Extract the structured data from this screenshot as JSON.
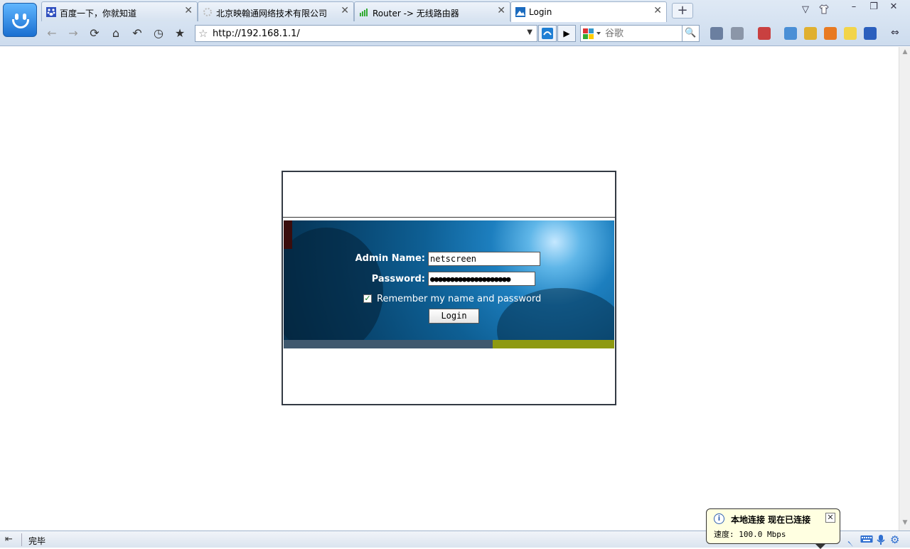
{
  "browser": {
    "tabs": [
      {
        "label": "百度一下，你就知道"
      },
      {
        "label": "北京映翰通网络技术有限公司"
      },
      {
        "label": "Router -> 无线路由器"
      },
      {
        "label": "Login"
      }
    ],
    "address": "http://192.168.1.1/",
    "search_placeholder": "谷歌"
  },
  "login": {
    "admin_label": "Admin Name:",
    "admin_value": "netscreen",
    "password_label": "Password:",
    "password_value": "●●●●●●●●●●●●●●●●●●●●",
    "remember_label": "Remember my name and password",
    "remember_checked": true,
    "login_button": "Login"
  },
  "status": {
    "text": "完毕"
  },
  "notification": {
    "title": "本地连接 现在已连接",
    "speed": "速度: 100.0 Mbps"
  },
  "colors": {
    "accent_bar_left": "#3f586e",
    "accent_bar_right": "#8e9a11",
    "banner_blue": "#0e5f94"
  }
}
